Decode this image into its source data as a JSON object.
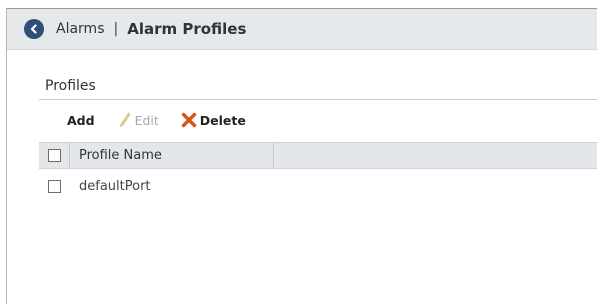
{
  "breadcrumb": {
    "parent": "Alarms",
    "separator": "|",
    "current": "Alarm Profiles"
  },
  "profiles": {
    "section_title": "Profiles",
    "toolbar": {
      "add_label": "Add",
      "edit_label": "Edit",
      "delete_label": "Delete"
    },
    "table": {
      "columns": [
        "Profile Name"
      ],
      "rows": [
        {
          "name": "defaultPort",
          "checked": false
        }
      ]
    }
  },
  "icons": {
    "back": "chevron-left-circle-icon",
    "edit": "pencil-icon",
    "delete": "x-icon"
  },
  "colors": {
    "back_icon_bg": "#2d4f78",
    "header_bg": "#e6e9ec",
    "delete_icon": "#d8541b",
    "edit_disabled": "#a7a7a7"
  }
}
